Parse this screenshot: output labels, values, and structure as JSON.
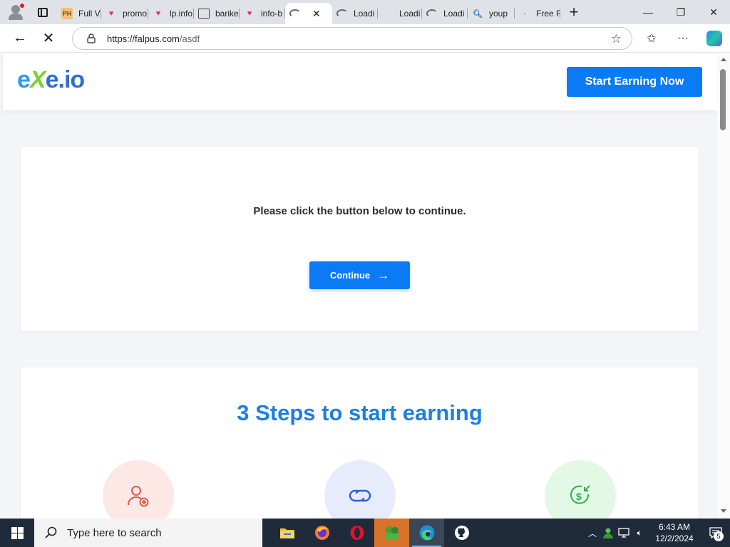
{
  "browser": {
    "tabs": [
      {
        "title": "Full V",
        "favicon": "ph-icon"
      },
      {
        "title": "promo",
        "favicon": "heart-icon"
      },
      {
        "title": "lp.info",
        "favicon": "heart-icon"
      },
      {
        "title": "barike",
        "favicon": "document-icon"
      },
      {
        "title": "info-b",
        "favicon": "heart-icon"
      },
      {
        "title": "",
        "favicon": "loading-icon",
        "active": true
      },
      {
        "title": "Loadi",
        "favicon": "loading-icon"
      },
      {
        "title": "Loadi",
        "favicon": "loading-icon"
      },
      {
        "title": "Loadi",
        "favicon": "loading-icon"
      },
      {
        "title": "youp",
        "favicon": "search-icon"
      },
      {
        "title": "Free P",
        "favicon": "loading-icon"
      }
    ],
    "url_host": "https://falpus.com",
    "url_path": "/asdf"
  },
  "site": {
    "logo_e": "e",
    "logo_x": "X",
    "logo_rest": "e.io",
    "header_button": "Start Earning Now",
    "prompt": "Please click the button below to continue.",
    "continue_label": "Continue",
    "continue_arrow": "→",
    "steps_title": "3 Steps to start earning"
  },
  "taskbar": {
    "search_placeholder": "Type here to search",
    "time": "6:43 AM",
    "date": "12/2/2024",
    "notification_count": "5"
  },
  "colors": {
    "accent_blue": "#0b7bf5",
    "steps_title": "#1f7fe0",
    "taskbar": "#1f2b3a"
  }
}
